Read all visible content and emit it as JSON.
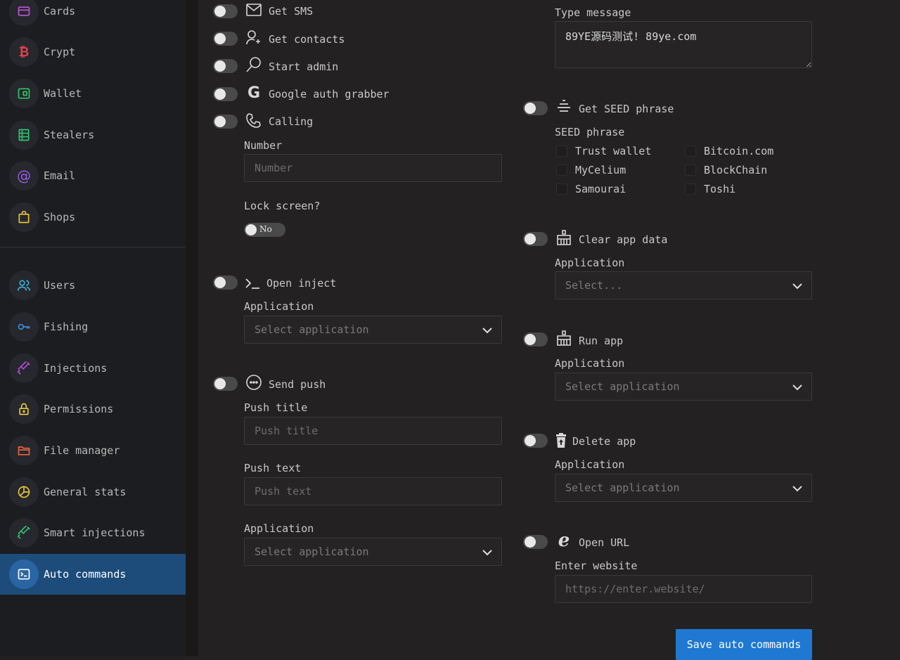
{
  "sidebar": {
    "items": [
      {
        "label": "Cards",
        "icon": "card-icon",
        "color": "#c052d8"
      },
      {
        "label": "Crypt",
        "icon": "bitcoin-icon",
        "color": "#e0434a"
      },
      {
        "label": "Wallet",
        "icon": "wallet-icon",
        "color": "#33c26b"
      },
      {
        "label": "Stealers",
        "icon": "stealers-icon",
        "color": "#34c06f"
      },
      {
        "label": "Email",
        "icon": "at-icon",
        "color": "#9b5de5"
      },
      {
        "label": "Shops",
        "icon": "shopping-bag-icon",
        "color": "#e8c53a"
      },
      {
        "label": "Users",
        "icon": "users-icon",
        "color": "#3bb2d6"
      },
      {
        "label": "Fishing",
        "icon": "key-icon",
        "color": "#3b8fe0"
      },
      {
        "label": "Injections",
        "icon": "syringe-icon",
        "color": "#b54bd6"
      },
      {
        "label": "Permissions",
        "icon": "lock-icon",
        "color": "#e8c53a"
      },
      {
        "label": "File manager",
        "icon": "folder-icon",
        "color": "#e8643a"
      },
      {
        "label": "General stats",
        "icon": "pie-chart-icon",
        "color": "#e8c53a"
      },
      {
        "label": "Smart injections",
        "icon": "syringe-icon",
        "color": "#34c06f"
      },
      {
        "label": "Auto commands",
        "icon": "terminal-icon",
        "color": "#ffffff"
      }
    ]
  },
  "left": {
    "get_sms": "Get SMS",
    "get_contacts": "Get contacts",
    "start_admin": "Start admin",
    "google_auth": "Google auth grabber",
    "calling": "Calling",
    "number_label": "Number",
    "number_placeholder": "Number",
    "lock_screen_label": "Lock screen?",
    "lock_screen_value": "No",
    "open_inject": "Open inject",
    "inject_app_label": "Application",
    "inject_app_placeholder": "Select application",
    "send_push": "Send push",
    "push_title_label": "Push title",
    "push_title_placeholder": "Push title",
    "push_text_label": "Push text",
    "push_text_placeholder": "Push text",
    "push_app_label": "Application",
    "push_app_placeholder": "Select application"
  },
  "right": {
    "type_message_label": "Type message",
    "type_message_value": "89YE源码测试! 89ye.com",
    "seed": "Get SEED phrase",
    "seed_label": "SEED phrase",
    "seed_options": [
      "Trust wallet",
      "Bitcoin.com",
      "MyCelium",
      "BlockChain",
      "Samourai",
      "Toshi"
    ],
    "clear_app": "Clear app data",
    "clear_app_label": "Application",
    "clear_app_placeholder": "Select...",
    "run_app": "Run app",
    "run_app_label": "Application",
    "run_app_placeholder": "Select application",
    "delete_app": "Delete app",
    "delete_app_label": "Application",
    "delete_app_placeholder": "Select application",
    "open_url": "Open URL",
    "url_label": "Enter website",
    "url_placeholder": "https://enter.website/",
    "save_button": "Save auto commands"
  }
}
